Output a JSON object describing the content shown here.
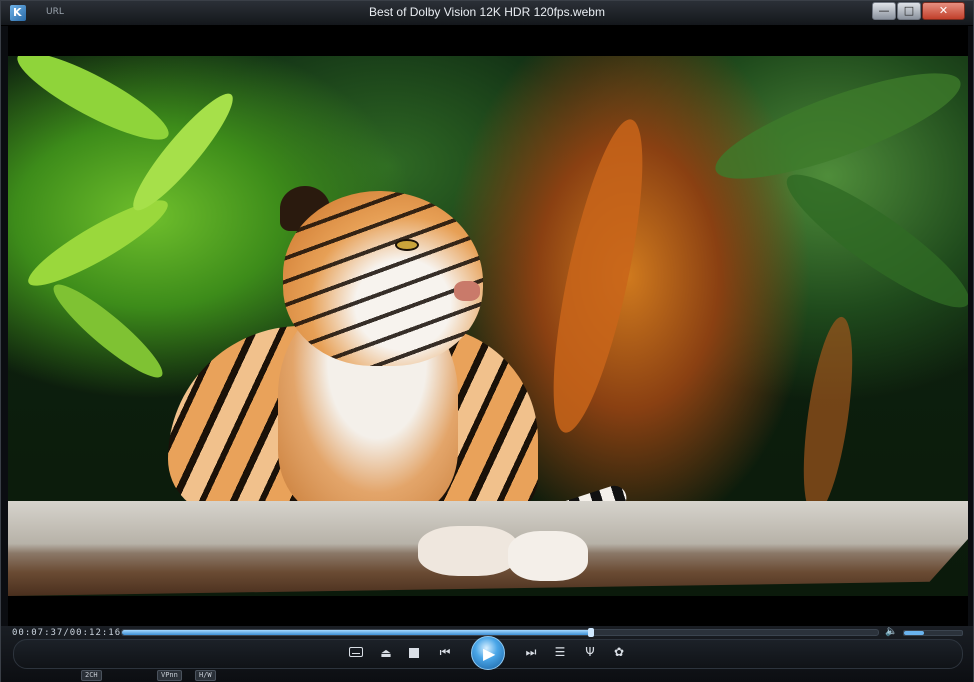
{
  "window": {
    "title": "Best of Dolby Vision 12K HDR 120fps.webm",
    "url_label": "URL",
    "app_icon_letter": "K",
    "buttons": {
      "minimize": "—",
      "maximize": "□",
      "close": "✕"
    }
  },
  "playback": {
    "time_text": "00:07:37/00:12:16",
    "progress_fraction": 0.62,
    "volume_fraction": 0.35
  },
  "controls": {
    "subtitle_icon": "subtitle-icon",
    "eject_icon": "eject-icon",
    "stop_icon": "stop-icon",
    "prev_icon": "skip-previous-icon",
    "play_icon": "play-icon",
    "next_icon": "skip-next-icon",
    "playlist_icon": "playlist-icon",
    "effects_icon": "audio-effects-icon",
    "settings_icon": "gear-icon",
    "eject_glyph": "⏏",
    "prev_glyph": "⏮",
    "play_glyph": "▶",
    "next_glyph": "⏭",
    "playlist_glyph": "☰",
    "effects_glyph": "Ψ",
    "settings_glyph": "✿",
    "volume_glyph": "🔈"
  },
  "status": {
    "channels": "2CH",
    "decoder": "VPnn",
    "hw": "H/W"
  },
  "colors": {
    "accent": "#3c8fd6",
    "close_button": "#c1402b"
  }
}
